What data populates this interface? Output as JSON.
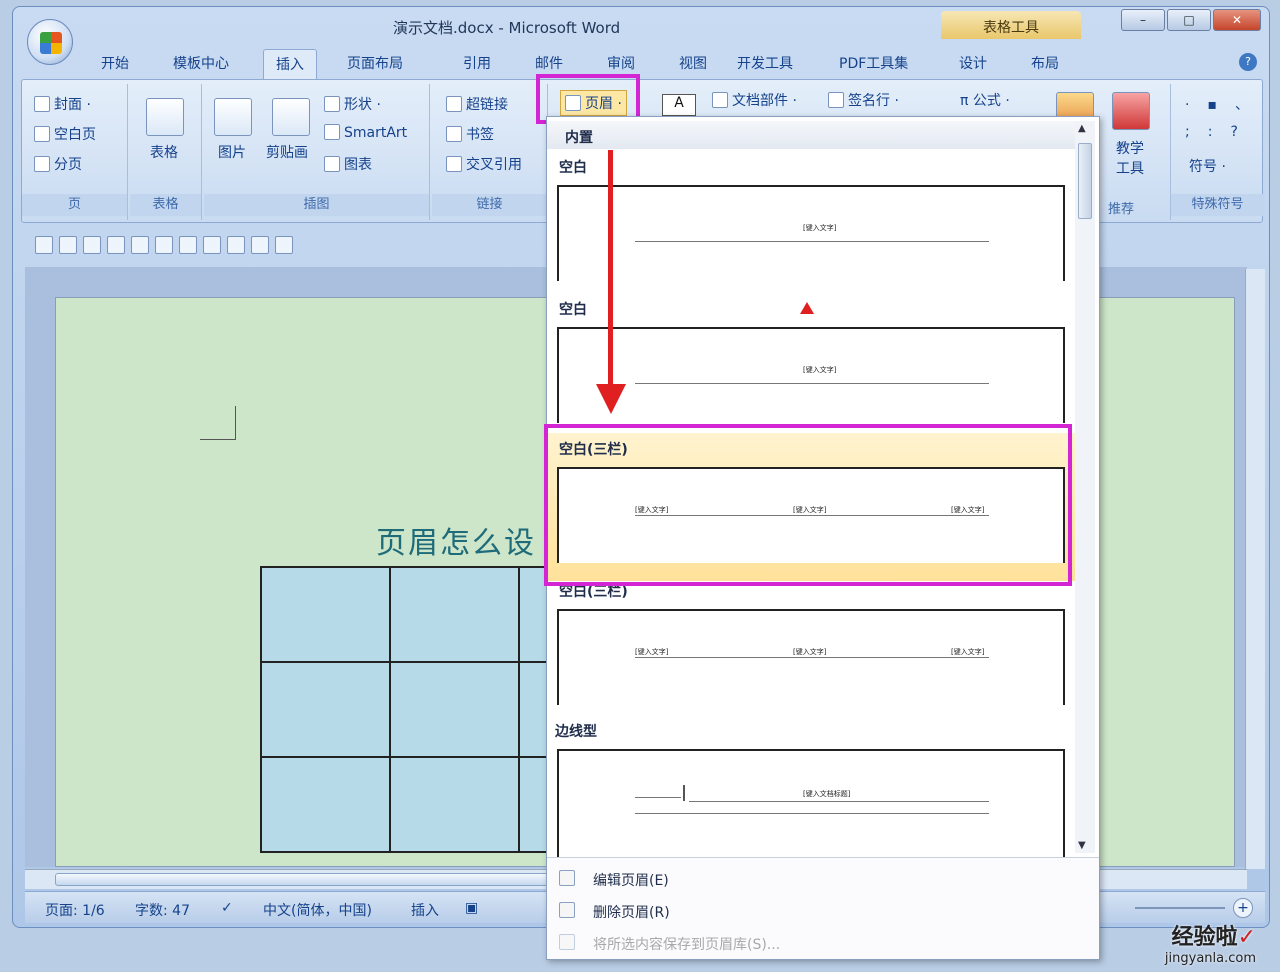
{
  "window": {
    "title": "演示文档.docx - Microsoft Word",
    "context_tab": "表格工具",
    "min": "–",
    "max": "□",
    "close": "✕"
  },
  "tabs": [
    "开始",
    "模板中心",
    "插入",
    "页面布局",
    "引用",
    "邮件",
    "审阅",
    "视图",
    "开发工具",
    "PDF工具集",
    "设计",
    "布局"
  ],
  "ribbon": {
    "page_group": {
      "label": "页",
      "items": [
        "封面 ·",
        "空白页",
        "分页"
      ]
    },
    "table_group": {
      "label": "表格",
      "button": "表格"
    },
    "illus_group": {
      "label": "插图",
      "picture": "图片",
      "clipart": "剪贴画",
      "shapes": "形状 ·",
      "smartart": "SmartArt",
      "chart": "图表"
    },
    "links_group": {
      "label": "链接",
      "items": [
        "超链接",
        "书签",
        "交叉引用"
      ]
    },
    "header_btn": "页眉 ·",
    "textbox_btn": "A",
    "docparts": "文档部件 ·",
    "signature": "签名行 ·",
    "formula": "π 公式 ·",
    "teach": "教学\n工具",
    "teach_short": "教学",
    "tools_short": "工具",
    "recommend": "推荐",
    "symbols_group": {
      "label": "特殊符号",
      "symbol": "符号 ·",
      "chars": [
        "·",
        "▪",
        "、",
        ";",
        ":",
        "?"
      ]
    }
  },
  "document": {
    "title": "页眉怎么设"
  },
  "status": {
    "page": "页面: 1/6",
    "words": "字数: 47",
    "lang": "中文(简体，中国)",
    "mode": "插入"
  },
  "dropdown": {
    "section": "内置",
    "items": [
      {
        "label": "空白",
        "placeholders": [
          "[键入文字]"
        ]
      },
      {
        "label": "空白",
        "placeholders": [
          "[键入文字]"
        ]
      },
      {
        "label": "空白(三栏)",
        "placeholders": [
          "[键入文字]",
          "[键入文字]",
          "[键入文字]"
        ]
      },
      {
        "label": "空白(三栏)",
        "placeholders": [
          "[键入文字]",
          "[键入文字]",
          "[键入文字]"
        ]
      },
      {
        "label": "边线型",
        "placeholders": [
          "[键入文档标题]"
        ]
      }
    ],
    "menu": [
      "编辑页眉(E)",
      "删除页眉(R)",
      "将所选内容保存到页眉库(S)..."
    ]
  },
  "watermark": {
    "line1": "经验啦",
    "check": "✓",
    "line2": "jingyanla.com"
  },
  "colors": {
    "highlight": "#d425d4",
    "arrow": "#e02020"
  }
}
